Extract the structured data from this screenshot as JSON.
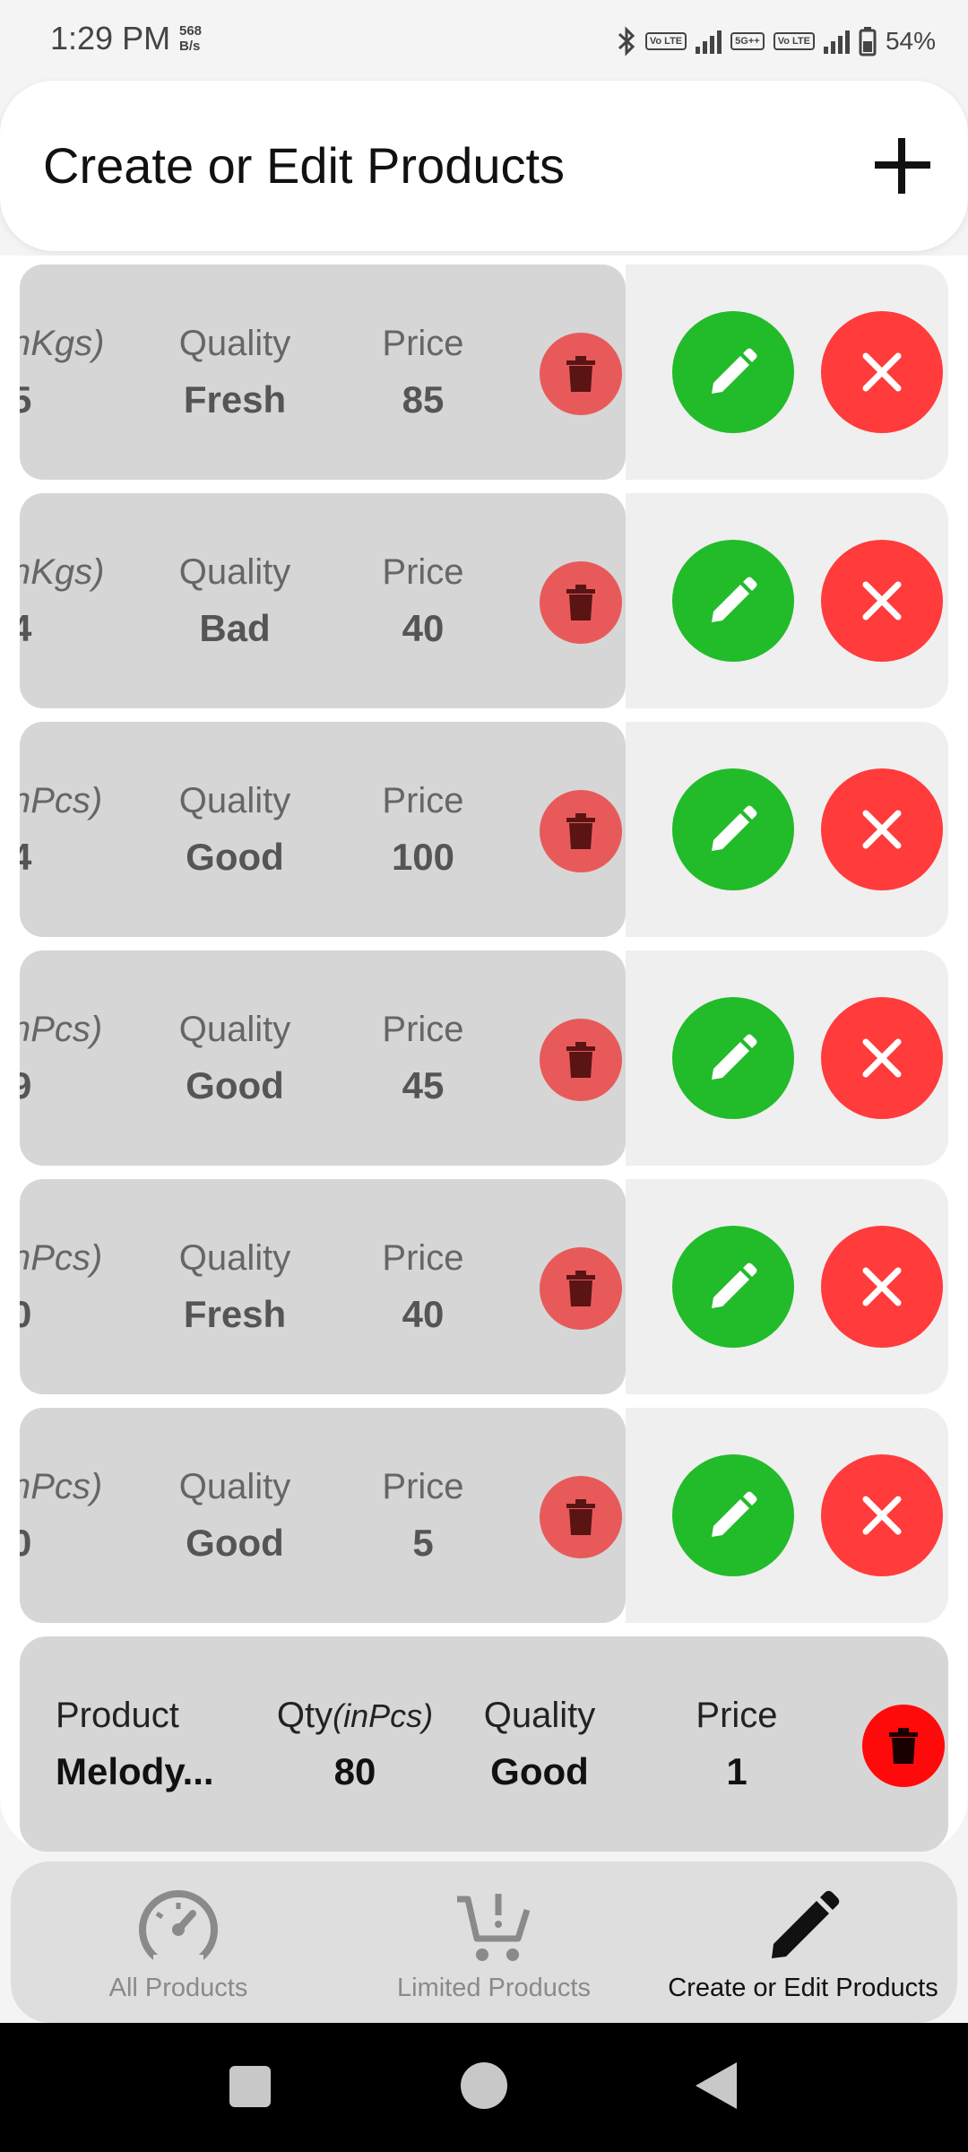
{
  "status_bar": {
    "time": "1:29 PM",
    "net_speed_value": "568",
    "net_speed_unit": "B/s",
    "volte_1": "Vo LTE",
    "network_5g": "5G++",
    "volte_2": "Vo LTE",
    "battery": "54%"
  },
  "header": {
    "title": "Create or Edit Products",
    "add_icon": "plus-icon"
  },
  "rows": [
    {
      "qty_label": "nKgs)",
      "qty_value": "5",
      "quality_label": "Quality",
      "quality_value": "Fresh",
      "price_label": "Price",
      "price_value": "85"
    },
    {
      "qty_label": "nKgs)",
      "qty_value": "4",
      "quality_label": "Quality",
      "quality_value": "Bad",
      "price_label": "Price",
      "price_value": "40"
    },
    {
      "qty_label": "nPcs)",
      "qty_value": "4",
      "quality_label": "Quality",
      "quality_value": "Good",
      "price_label": "Price",
      "price_value": "100"
    },
    {
      "qty_label": "nPcs)",
      "qty_value": "9",
      "quality_label": "Quality",
      "quality_value": "Good",
      "price_label": "Price",
      "price_value": "45"
    },
    {
      "qty_label": "nPcs)",
      "qty_value": "0",
      "quality_label": "Quality",
      "quality_value": "Fresh",
      "price_label": "Price",
      "price_value": "40"
    },
    {
      "qty_label": "nPcs)",
      "qty_value": "0",
      "quality_label": "Quality",
      "quality_value": "Good",
      "price_label": "Price",
      "price_value": "5"
    }
  ],
  "last_row": {
    "product_label": "Product",
    "product_value": "Melody...",
    "qty_label_main": "Qty",
    "qty_label_unit": "(inPcs)",
    "qty_value": "80",
    "quality_label": "Quality",
    "quality_value": "Good",
    "price_label": "Price",
    "price_value": "1"
  },
  "bottom_nav": {
    "items": [
      {
        "label": "All Products",
        "icon": "speedometer-icon",
        "active": false
      },
      {
        "label": "Limited Products",
        "icon": "cart-alert-icon",
        "active": false
      },
      {
        "label": "Create or Edit Products",
        "icon": "pencil-icon",
        "active": true
      }
    ]
  },
  "colors": {
    "edit_button": "#22bb2a",
    "close_button": "#ff3b3b",
    "row_trash": "#e85a5a",
    "last_row_trash": "#ff0a0a"
  }
}
